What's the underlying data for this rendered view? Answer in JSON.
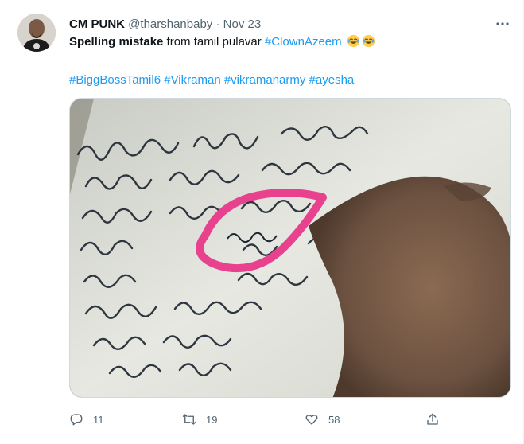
{
  "tweet": {
    "author_name": "CM PUNK",
    "handle": "@tharshanbaby",
    "separator": "·",
    "time": "Nov 23",
    "text_bold": "Spelling mistake",
    "text_plain": " from tamil pulavar ",
    "hashtag_main": "#ClownAzeem",
    "hashtags": [
      "#BiggBossTamil6",
      "#Vikraman",
      "#vikramanarmy",
      "#ayesha"
    ],
    "replies": "11",
    "retweets": "19",
    "likes": "58",
    "icons": [
      "more-icon",
      "reply-icon",
      "retweet-icon",
      "like-icon",
      "share-icon",
      "laughing-emoji"
    ],
    "colors": {
      "link": "#1d9bf0",
      "muted": "#536471",
      "highlight_circle": "#e8418d"
    }
  }
}
